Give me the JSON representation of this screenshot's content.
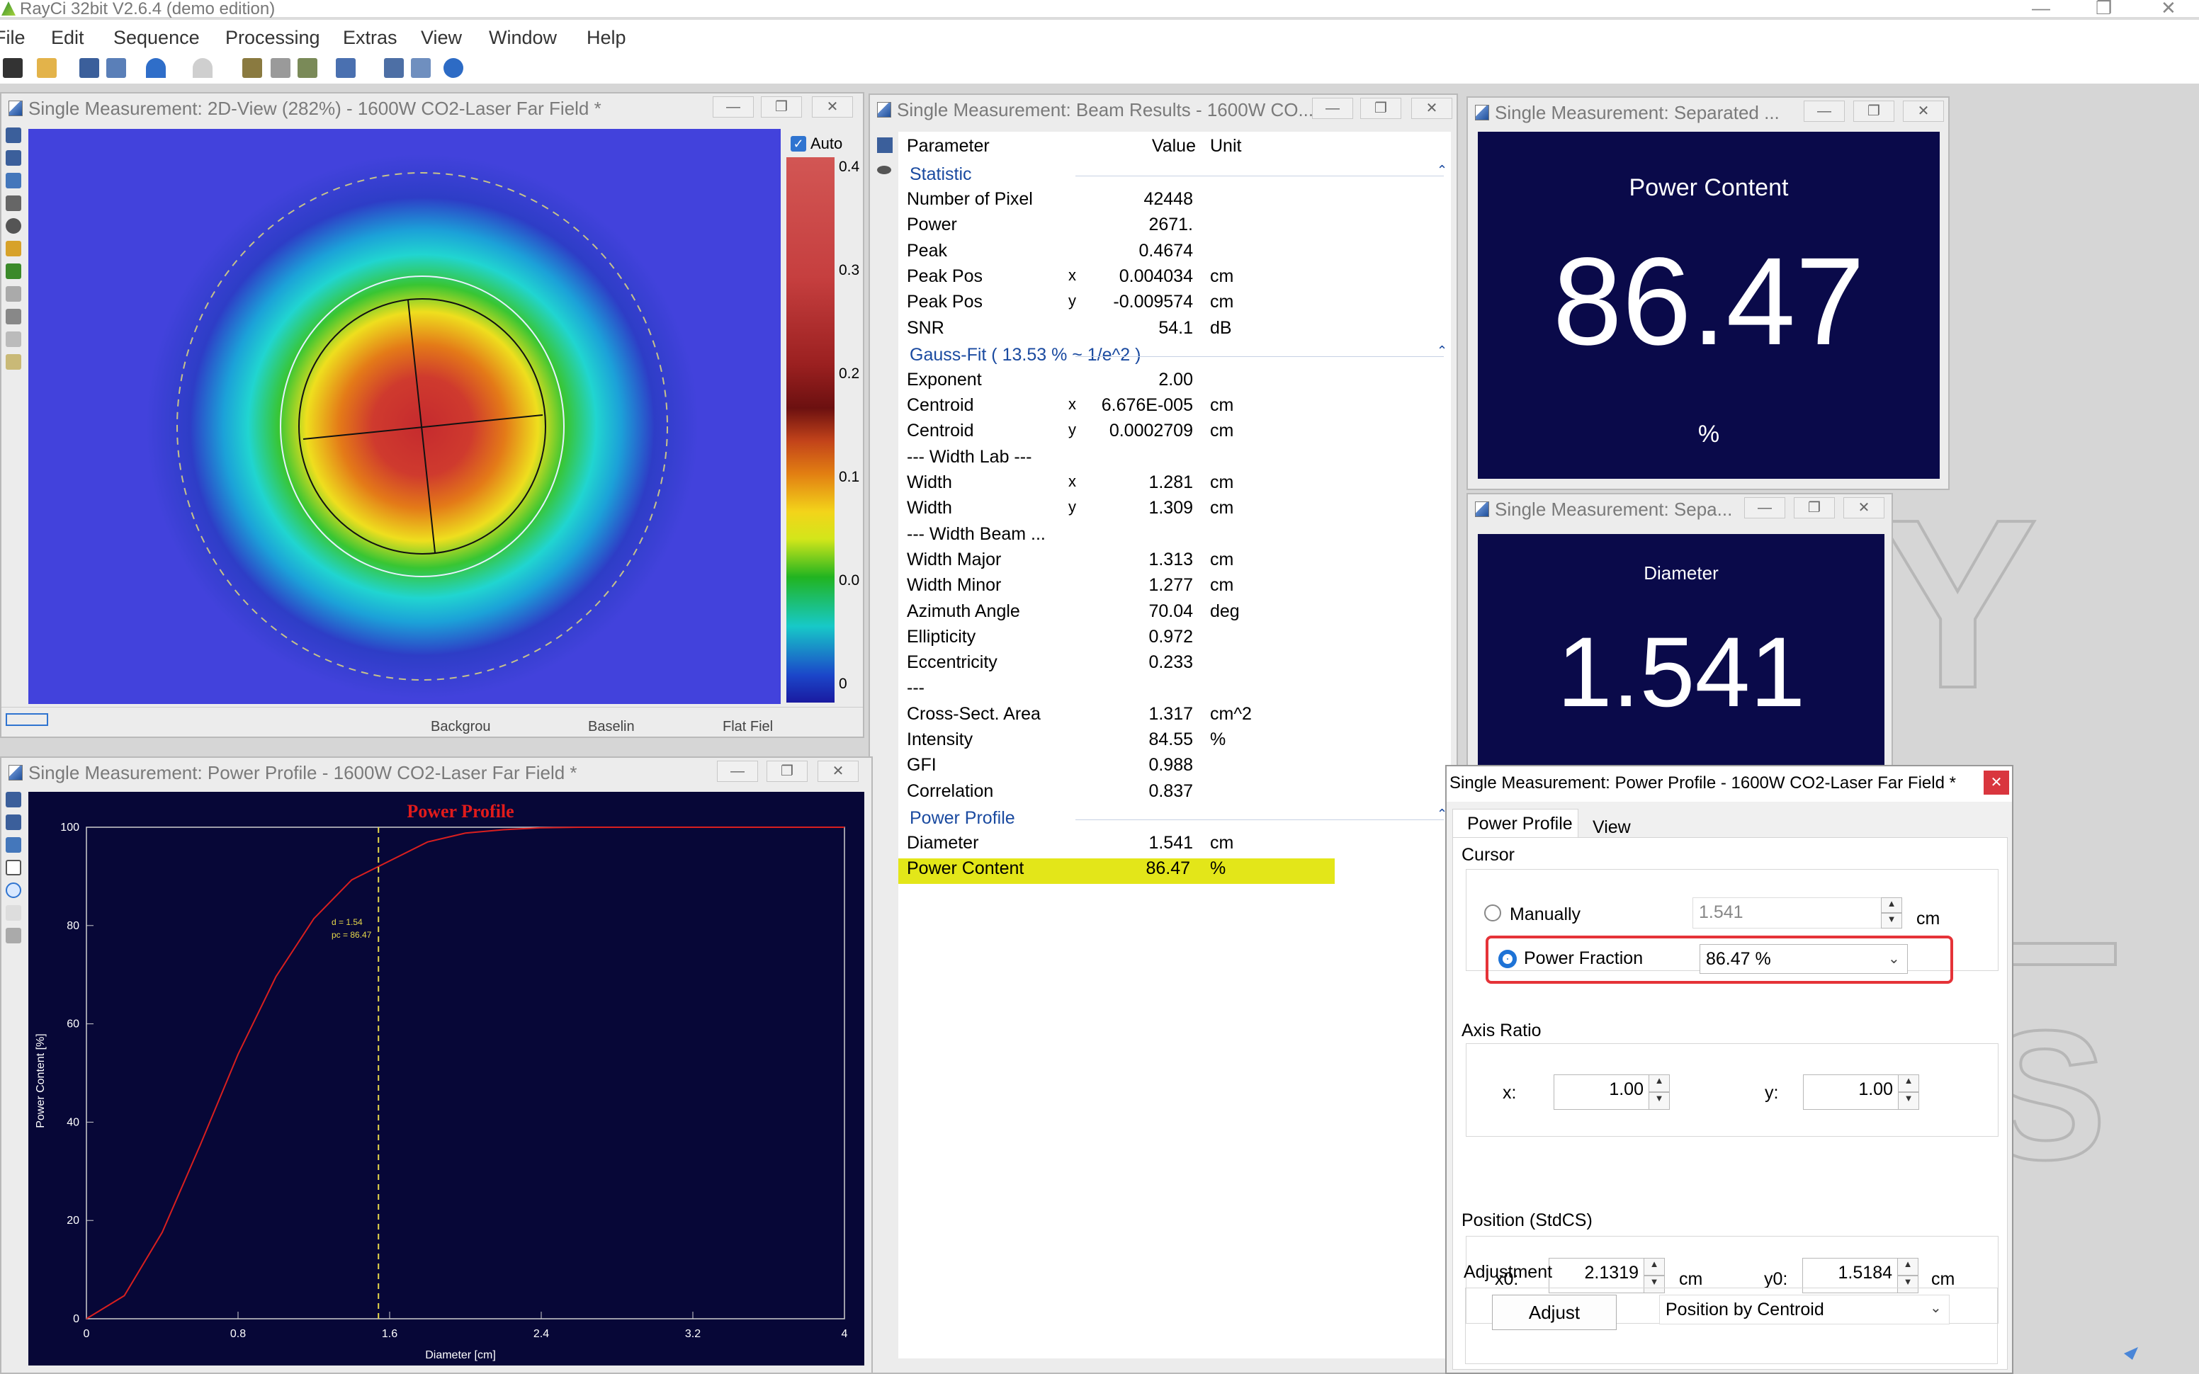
{
  "app": {
    "title": "RayCi 32bit V2.6.4 (demo edition)"
  },
  "menu": [
    "File",
    "Edit",
    "Sequence",
    "Processing",
    "Extras",
    "View",
    "Window",
    "Help"
  ],
  "icons": {
    "minimize": "minimize-icon",
    "restore": "restore-icon",
    "close": "close-icon"
  },
  "view2d": {
    "title": "Single Measurement: 2D-View (282%) - 1600W CO2-Laser Far Field *",
    "auto_label": "Auto",
    "scale_ticks": [
      "0.4",
      "0.3",
      "0.2",
      "0.1",
      "0.0",
      "0"
    ],
    "bottom_labels": [
      "Backgrou",
      "Baselin",
      "Flat Fiel"
    ]
  },
  "results": {
    "title": "Single Measurement: Beam Results - 1600W CO...",
    "headers": {
      "parameter": "Parameter",
      "value": "Value",
      "unit": "Unit"
    },
    "sections": [
      {
        "name": "Statistic",
        "rows": [
          [
            "Number of Pixel",
            "",
            "42448",
            ""
          ],
          [
            "Power",
            "",
            "2671.",
            ""
          ],
          [
            "Peak",
            "",
            "0.4674",
            ""
          ],
          [
            "Peak Pos",
            "x",
            "0.004034",
            "cm"
          ],
          [
            "Peak Pos",
            "y",
            "-0.009574",
            "cm"
          ],
          [
            "SNR",
            "",
            "54.1",
            "dB"
          ]
        ]
      },
      {
        "name": "Gauss-Fit ( 13.53 % ~ 1/e^2 )",
        "rows": [
          [
            "Exponent",
            "",
            "2.00",
            ""
          ],
          [
            "Centroid",
            "x",
            "6.676E-005",
            "cm"
          ],
          [
            "Centroid",
            "y",
            "0.0002709",
            "cm"
          ],
          [
            "--- Width Lab ---",
            "",
            "",
            ""
          ],
          [
            "Width",
            "x",
            "1.281",
            "cm"
          ],
          [
            "Width",
            "y",
            "1.309",
            "cm"
          ],
          [
            "--- Width Beam ...",
            "",
            "",
            ""
          ],
          [
            "Width Major",
            "",
            "1.313",
            "cm"
          ],
          [
            "Width Minor",
            "",
            "1.277",
            "cm"
          ],
          [
            "Azimuth Angle",
            "",
            "70.04",
            "deg"
          ],
          [
            "Ellipticity",
            "",
            "0.972",
            ""
          ],
          [
            "Eccentricity",
            "",
            "0.233",
            ""
          ],
          [
            "---",
            "",
            "",
            ""
          ],
          [
            "Cross-Sect. Area",
            "",
            "1.317",
            "cm^2"
          ],
          [
            "Intensity",
            "",
            "84.55",
            "%"
          ],
          [
            "GFI",
            "",
            "0.988",
            ""
          ],
          [
            "Correlation",
            "",
            "0.837",
            ""
          ]
        ]
      },
      {
        "name": "Power Profile",
        "rows": [
          [
            "Diameter",
            "",
            "1.541",
            "cm"
          ],
          [
            "Power Content",
            "",
            "86.47",
            "%"
          ]
        ]
      }
    ]
  },
  "sep1": {
    "title": "Single Measurement: Separated ...",
    "label": "Power Content",
    "value": "86.47",
    "unit": "%"
  },
  "sep2": {
    "title": "Single Measurement: Sepa...",
    "label": "Diameter",
    "value": "1.541",
    "unit": "cm"
  },
  "profile": {
    "title": "Single Measurement: Power Profile - 1600W CO2-Laser Far Field *",
    "cursor_d": "d = 1.54",
    "cursor_pc": "pc = 86.47"
  },
  "chart_data": {
    "type": "line",
    "title": "Power Profile",
    "xlabel": "Diameter [cm]",
    "ylabel": "Power Content [%]",
    "xlim": [
      0,
      4
    ],
    "ylim": [
      0,
      100
    ],
    "xticks": [
      "0",
      "0.8",
      "1.6",
      "2.4",
      "3.2",
      "4"
    ],
    "yticks": [
      "0",
      "20",
      "40",
      "60",
      "80",
      "100"
    ],
    "x": [
      0,
      0.2,
      0.4,
      0.6,
      0.8,
      1.0,
      1.2,
      1.4,
      1.541,
      1.8,
      2.0,
      2.2,
      2.4,
      2.6,
      4.0
    ],
    "y": [
      0,
      4.7,
      17.6,
      35.3,
      53.8,
      69.6,
      81.4,
      89.3,
      86.47,
      97,
      98.8,
      99.5,
      99.9,
      100,
      100
    ],
    "cursor_x": 1.541
  },
  "dialog": {
    "title": "Single Measurement: Power Profile - 1600W CO2-Laser Far Field *",
    "tabs": [
      "Power Profile",
      "View"
    ],
    "cursor_group": "Cursor",
    "manually_label": "Manually",
    "manually_value": "1.541",
    "manually_unit": "cm",
    "fraction_label": "Power Fraction",
    "fraction_value": "86.47 %",
    "axis_group": "Axis Ratio",
    "x_label": "x:",
    "x_value": "1.00",
    "y_label": "y:",
    "y_value": "1.00",
    "pos_group": "Position (StdCS)",
    "x0_label": "x0:",
    "x0_value": "2.1319",
    "x0_unit": "cm",
    "y0_label": "y0:",
    "y0_value": "1.5184",
    "y0_unit": "cm",
    "adj_group": "Adjustment",
    "adjust_button": "Adjust",
    "adjust_mode": "Position by Centroid"
  }
}
